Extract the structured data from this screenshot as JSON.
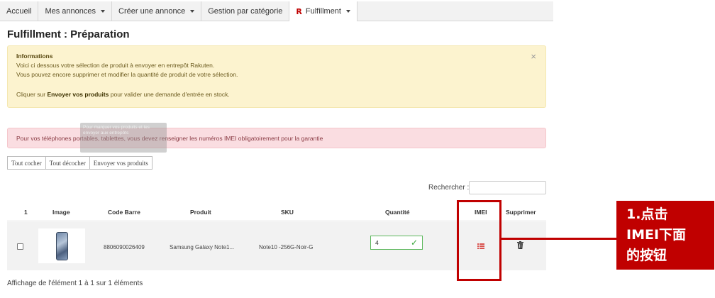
{
  "nav": {
    "items": [
      {
        "label": "Accueil",
        "dropdown": false
      },
      {
        "label": "Mes annonces",
        "dropdown": true
      },
      {
        "label": "Créer une annonce",
        "dropdown": true
      },
      {
        "label": "Gestion par catégorie",
        "dropdown": false
      },
      {
        "label": "Fulfillment",
        "dropdown": true,
        "icon": "rakuten-r-icon",
        "active": true
      }
    ]
  },
  "page": {
    "title": "Fulfillment : Préparation"
  },
  "info_alert": {
    "title": "Informations",
    "line1": "Voici ci dessous votre sélection de produit à envoyer en entrepôt Rakuten.",
    "line2": "Vous pouvez encore supprimer et modifier la quantité de produit de votre sélection.",
    "cta_prefix": "Cliquer sur ",
    "cta_bold": "Envoyer vos produits",
    "cta_suffix": " pour valider une demande d'entrée en stock.",
    "close": "×"
  },
  "danger_alert": {
    "text": "Pour vos téléphones portables, tablettes, vous devez renseigner les numéros IMEI obligatoirement pour la garantie"
  },
  "tooltip": {
    "text": "Pour marquer vos produits et les envoyer aux entrepôts"
  },
  "actions": {
    "check_all": "Tout cocher",
    "uncheck_all": "Tout décocher",
    "send": "Envoyer vos produits"
  },
  "search": {
    "label": "Rechercher :",
    "value": ""
  },
  "table": {
    "headers": {
      "index": "1",
      "image": "Image",
      "barcode": "Code Barre",
      "product": "Produit",
      "sku": "SKU",
      "quantity": "Quantité",
      "imei": "IMEI",
      "delete": "Supprimer"
    },
    "rows": [
      {
        "barcode": "8806090026409",
        "product": "Samsung Galaxy Note1...",
        "sku": "Note10 -256G-Noir-G",
        "quantity": "4"
      }
    ]
  },
  "footer": {
    "info": "Affichage de l'élément 1 à 1 sur 1 éléments"
  },
  "annotation": {
    "line1": "1.点击",
    "line2": "IMEI下面",
    "line3": "的按钮"
  },
  "colors": {
    "annotation_red": "#c00000",
    "valid_green": "#5cb85c",
    "imei_red": "#d9534f"
  }
}
